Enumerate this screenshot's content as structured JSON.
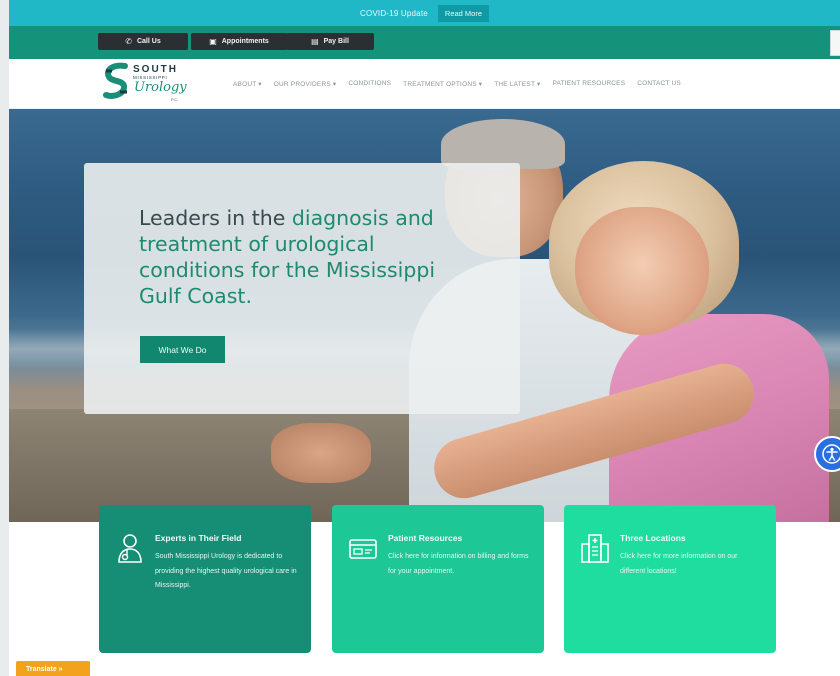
{
  "covid": {
    "text": "COVID-19 Update",
    "button": "Read More"
  },
  "actions": {
    "call": "Call Us",
    "appointments": "Appointments",
    "pay_bill": "Pay Bill"
  },
  "logo": {
    "line1": "SOUTH",
    "line2": "MISSISSIPPI",
    "line3": "Urology",
    "line4": "P.C."
  },
  "nav": {
    "items": [
      "ABOUT ▾",
      "OUR PROVIDERS ▾",
      "CONDITIONS",
      "TREATMENT OPTIONS ▾",
      "THE LATEST ▾",
      "PATIENT RESOURCES",
      "CONTACT US"
    ]
  },
  "hero": {
    "title_part1": "Leaders in the ",
    "title_part2": "diagnosis and treatment of urological conditions for the Mississippi Gulf Coast.",
    "cta": "What We Do"
  },
  "features": [
    {
      "title": "Experts in Their Field",
      "text": "South Mississippi Urology is dedicated to providing the highest quality urological care in Mississippi.",
      "icon": "doctor-icon"
    },
    {
      "title": "Patient Resources",
      "text": "Click here for information on billing and forms for your appointment.",
      "icon": "forms-icon"
    },
    {
      "title": "Three Locations",
      "text": "Click here for more information on our different locations!",
      "icon": "building-icon"
    }
  ],
  "translate": "Translate »",
  "colors": {
    "teal": "#15927a",
    "banner": "#20b8c7",
    "cta": "#12876f",
    "accessibility": "#2a6fe0"
  }
}
